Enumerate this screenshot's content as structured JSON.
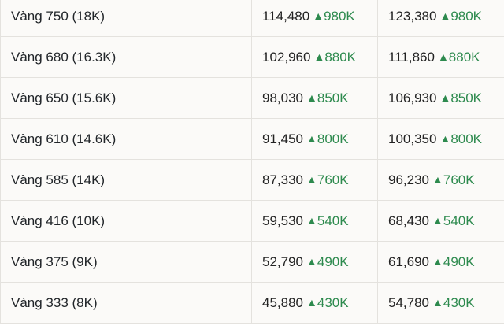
{
  "colors": {
    "up": "#2d8a4e",
    "text": "#222222",
    "row_bg": "#fbfaf8",
    "border": "#e4e2de"
  },
  "arrow_icon": "up-triangle-icon",
  "rows": [
    {
      "name": "Vàng 750 (18K)",
      "buy": "114,480",
      "buy_change": "980K",
      "sell": "123,380",
      "sell_change": "980K"
    },
    {
      "name": "Vàng 680 (16.3K)",
      "buy": "102,960",
      "buy_change": "880K",
      "sell": "111,860",
      "sell_change": "880K"
    },
    {
      "name": "Vàng 650 (15.6K)",
      "buy": "98,030",
      "buy_change": "850K",
      "sell": "106,930",
      "sell_change": "850K"
    },
    {
      "name": "Vàng 610 (14.6K)",
      "buy": "91,450",
      "buy_change": "800K",
      "sell": "100,350",
      "sell_change": "800K"
    },
    {
      "name": "Vàng 585 (14K)",
      "buy": "87,330",
      "buy_change": "760K",
      "sell": "96,230",
      "sell_change": "760K"
    },
    {
      "name": "Vàng 416 (10K)",
      "buy": "59,530",
      "buy_change": "540K",
      "sell": "68,430",
      "sell_change": "540K"
    },
    {
      "name": "Vàng 375 (9K)",
      "buy": "52,790",
      "buy_change": "490K",
      "sell": "61,690",
      "sell_change": "490K"
    },
    {
      "name": "Vàng 333 (8K)",
      "buy": "45,880",
      "buy_change": "430K",
      "sell": "54,780",
      "sell_change": "430K"
    }
  ]
}
